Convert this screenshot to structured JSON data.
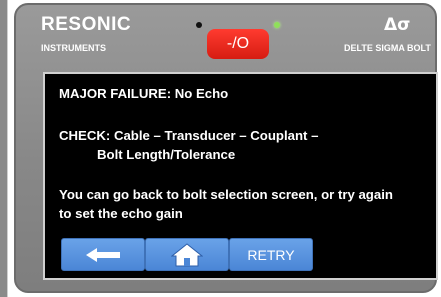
{
  "device": {
    "brand": "RESONIC",
    "brand_sub": "INSTRUMENTS",
    "power_label": "-/O",
    "symbol": "Δσ",
    "model": "DELTE SIGMA BOLT"
  },
  "screen": {
    "line1": "MAJOR FAILURE: No Echo",
    "line2": "CHECK: Cable – Transducer – Couplant –",
    "line3": "Bolt Length/Tolerance",
    "line4": "You can go back to bolt selection screen, or try again",
    "line5": "to set the echo gain"
  },
  "buttons": {
    "back_icon": "left-arrow-icon",
    "home_icon": "home-icon",
    "retry_label": "RETRY"
  },
  "colors": {
    "bezel": "#8c8c8c",
    "power_red": "#e8261c",
    "button_blue": "#5b96e0",
    "led_green": "#8fe05a"
  }
}
